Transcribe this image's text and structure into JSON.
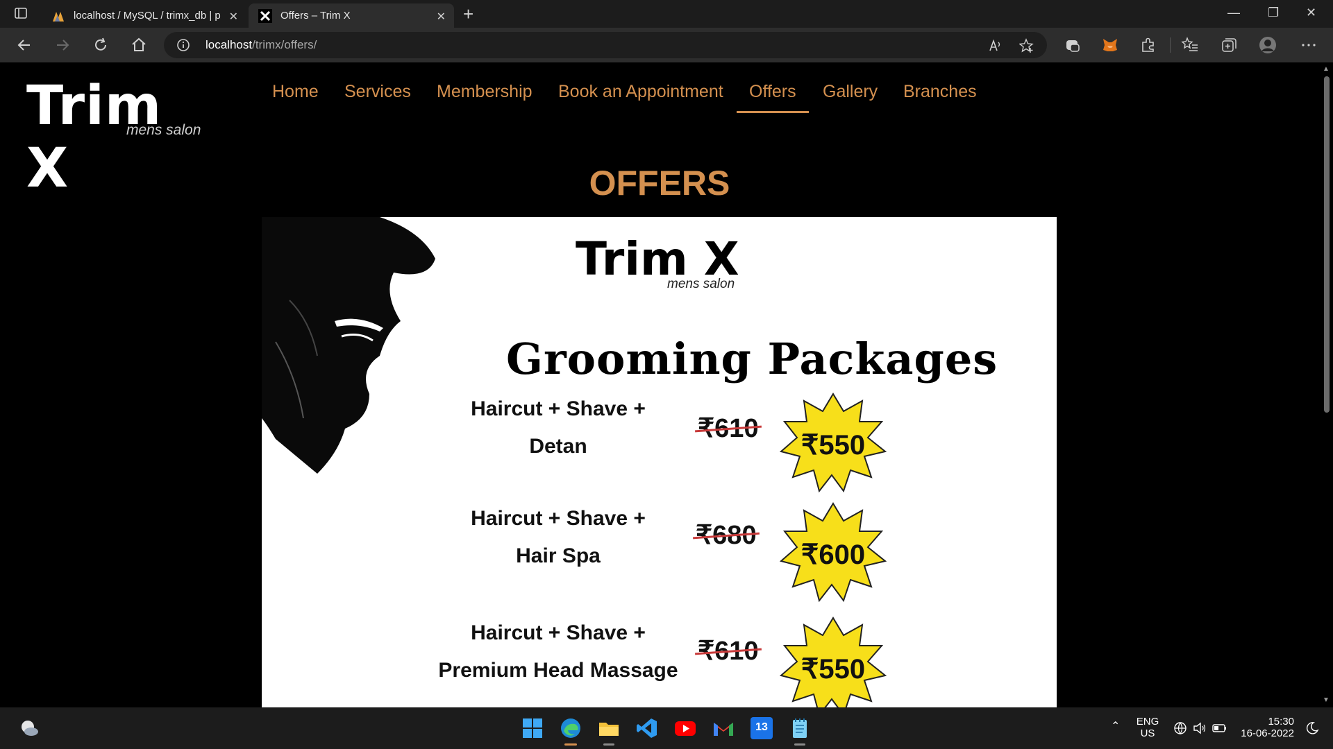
{
  "browser": {
    "tabs": [
      {
        "title": "localhost / MySQL / trimx_db | p",
        "favicon": "phpmyadmin-icon",
        "close": "✕"
      },
      {
        "title": "Offers – Trim X",
        "favicon": "trim-x-icon",
        "close": "✕"
      }
    ],
    "new_tab": "+",
    "window_controls": {
      "minimize": "—",
      "restore": "❐",
      "close": "✕"
    },
    "url_host": "localhost",
    "url_path": "/trimx/offers/"
  },
  "site": {
    "logo_main": "Trim X",
    "logo_sub": "mens salon",
    "nav": [
      {
        "label": "Home",
        "active": false
      },
      {
        "label": "Services",
        "active": false
      },
      {
        "label": "Membership",
        "active": false
      },
      {
        "label": "Book an Appointment",
        "active": false
      },
      {
        "label": "Offers",
        "active": true
      },
      {
        "label": "Gallery",
        "active": false
      },
      {
        "label": "Branches",
        "active": false
      }
    ],
    "page_title": "OFFERS",
    "accent_color": "#d4904f"
  },
  "poster": {
    "logo_main": "Trim X",
    "logo_sub": "mens salon",
    "heading": "Grooming Packages",
    "packages": [
      {
        "line1": "Haircut + Shave +",
        "line2": "Detan",
        "old_price": "₹610",
        "new_price": "₹550"
      },
      {
        "line1": "Haircut + Shave +",
        "line2": "Hair Spa",
        "old_price": "₹680",
        "new_price": "₹600"
      },
      {
        "line1": "Haircut + Shave +",
        "line2": "Premium Head Massage",
        "old_price": "₹610",
        "new_price": "₹550"
      }
    ]
  },
  "taskbar": {
    "apps": [
      "windows-start-icon",
      "edge-icon",
      "file-explorer-icon",
      "vscode-icon",
      "youtube-icon",
      "gmail-icon",
      "calendar-icon",
      "notepad-icon"
    ],
    "calendar_day": "13",
    "lang_line1": "ENG",
    "lang_line2": "US",
    "time": "15:30",
    "date": "16-06-2022"
  }
}
